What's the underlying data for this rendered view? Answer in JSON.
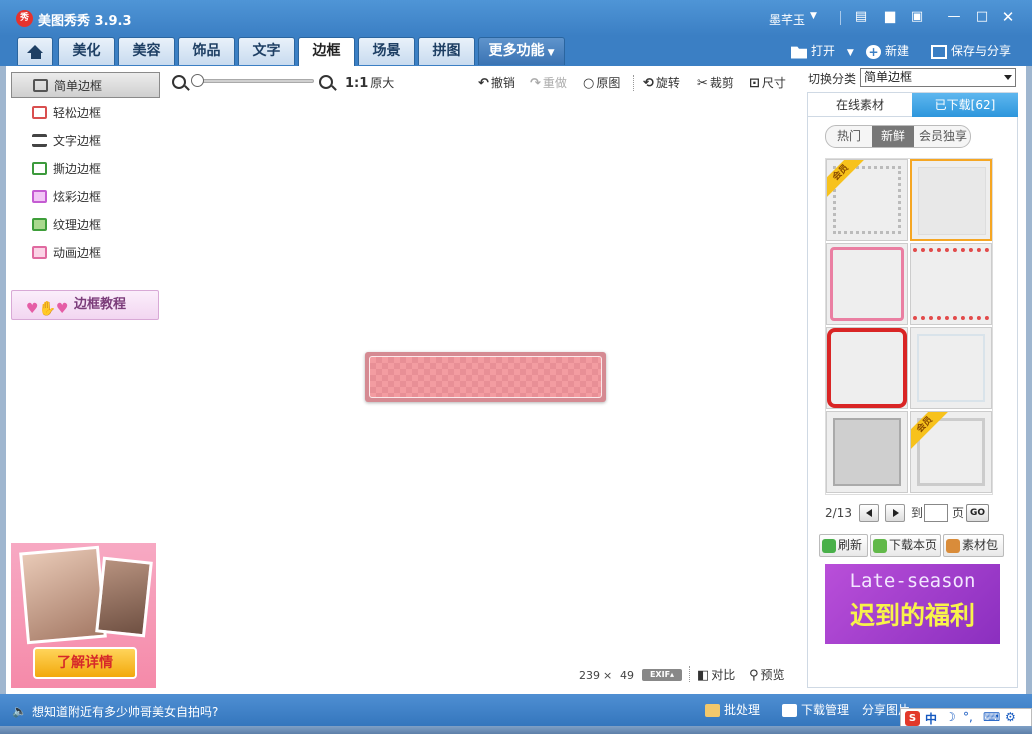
{
  "app": {
    "title": "美图秀秀 3.9.3",
    "logo_text": "秀",
    "user": "墨芊玉"
  },
  "tabs": [
    {
      "label": "美化"
    },
    {
      "label": "美容"
    },
    {
      "label": "饰品"
    },
    {
      "label": "文字"
    },
    {
      "label": "边框"
    },
    {
      "label": "场景"
    },
    {
      "label": "拼图"
    },
    {
      "label": "更多功能"
    }
  ],
  "actions": {
    "open": "打开",
    "new": "新建",
    "save_share": "保存与分享"
  },
  "sidebar": {
    "items": [
      {
        "label": "简单边框",
        "icon_color": "#555555"
      },
      {
        "label": "轻松边框",
        "icon_color": "#d94f4f"
      },
      {
        "label": "文字边框",
        "icon_color": "#444444"
      },
      {
        "label": "撕边边框",
        "icon_color": "#3c9a3c"
      },
      {
        "label": "炫彩边框",
        "icon_color": "#c45cd2"
      },
      {
        "label": "纹理边框",
        "icon_color": "#3e9e3a"
      },
      {
        "label": "动画边框",
        "icon_color": "#e06aa0"
      }
    ],
    "tutorial": "边框教程",
    "ad_button": "了解详情"
  },
  "toolbar": {
    "zoom_ratio": "1:1",
    "original_size": "原大",
    "undo": "撤销",
    "redo": "重做",
    "original": "原图",
    "rotate": "旋转",
    "crop": "裁剪",
    "size": "尺寸"
  },
  "canvas": {
    "width": "239",
    "times": "×",
    "height": "49",
    "exif": "EXIF▴",
    "compare": "对比",
    "preview": "预览"
  },
  "right_panel": {
    "category_label": "切换分类",
    "category_value": "简单边框",
    "tab_online": "在线素材",
    "tab_downloaded": "已下载[62]",
    "filters": [
      "热门",
      "新鲜",
      "会员独享"
    ],
    "vip_badge": "会员",
    "pager": {
      "current": "2/13",
      "goto": "到",
      "page": "页",
      "go": "GO"
    },
    "refresh": "刷新",
    "download_page": "下载本页",
    "pack": "素材包",
    "ad_en": "Late-season",
    "ad_cn": "迟到的福利"
  },
  "statusbar": {
    "message": "想知道附近有多少帅哥美女自拍吗?",
    "batch": "批处理",
    "download_mgr": "下载管理",
    "share": "分享图片"
  },
  "ime": {
    "brand": "S",
    "mode": "中"
  }
}
